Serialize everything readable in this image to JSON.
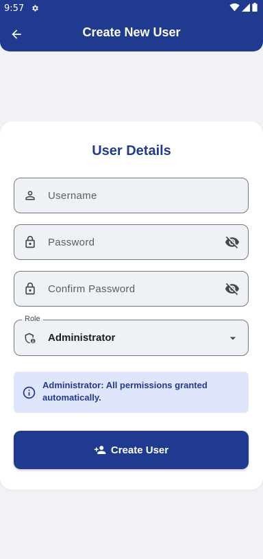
{
  "status_bar": {
    "time": "9:57",
    "icons": [
      "settings-icon",
      "wifi-icon",
      "signal-icon",
      "battery-icon"
    ]
  },
  "app_bar": {
    "title": "Create New User",
    "back_icon": "arrow-back-icon",
    "color": "#1f3a8f"
  },
  "form": {
    "title": "User Details",
    "username": {
      "placeholder": "Username",
      "value": "",
      "icon": "person-icon"
    },
    "password": {
      "placeholder": "Password",
      "value": "",
      "icon": "lock-icon",
      "toggle_icon": "visibility-off-icon"
    },
    "confirm_password": {
      "placeholder": "Confirm Password",
      "value": "",
      "icon": "lock-icon",
      "toggle_icon": "visibility-off-icon"
    },
    "role": {
      "label": "Role",
      "value": "Administrator",
      "icon": "admin-shield-icon",
      "dropdown_icon": "arrow-drop-down-icon"
    },
    "info": {
      "icon": "info-icon",
      "text": "Administrator: All permissions granted automatically."
    },
    "submit": {
      "label": "Create User",
      "icon": "person-add-icon"
    }
  },
  "colors": {
    "primary": "#1f3a8f",
    "background": "#f1f2f7",
    "info_background": "#dfe6fb"
  }
}
